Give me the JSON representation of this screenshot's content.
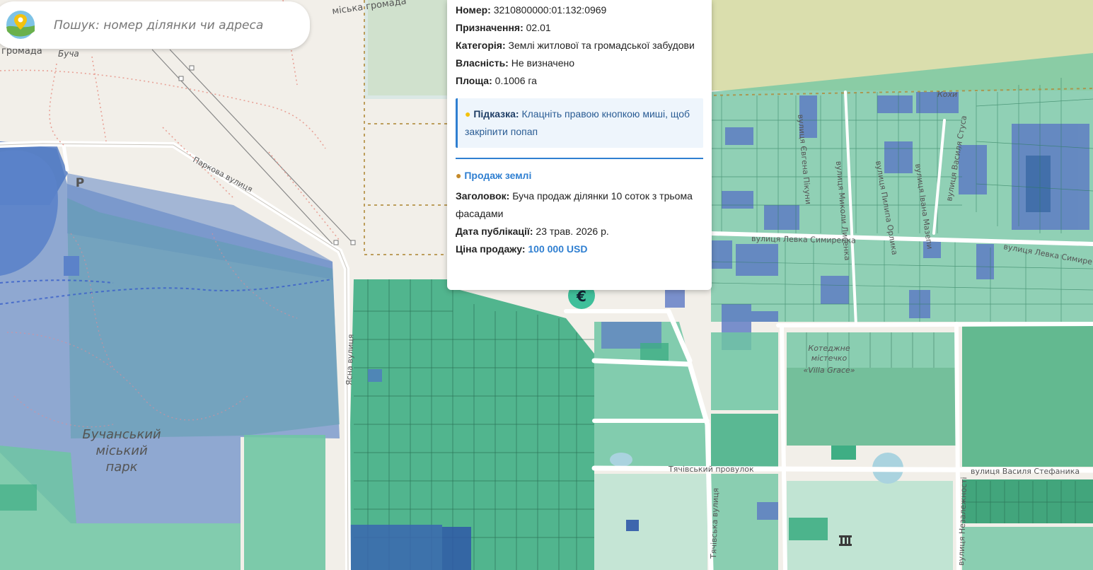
{
  "search": {
    "placeholder": "Пошук: номер ділянки чи адреса"
  },
  "popup": {
    "fields": [
      {
        "label": "Номер:",
        "value": "3210800000:01:132:0969"
      },
      {
        "label": "Призначення:",
        "value": "02.01"
      },
      {
        "label": "Категорія:",
        "value": "Землі житлової та громадської забудови"
      },
      {
        "label": "Власність:",
        "value": "Не визначено"
      },
      {
        "label": "Площа:",
        "value": "0.1006 га"
      }
    ],
    "hint": {
      "icon": "lightbulb-icon",
      "label": "Підказка:",
      "text": "Клацніть правою кнопкою миші, щоб закріпити попап"
    },
    "sale": {
      "icon": "money-bag-icon",
      "title": "Продаж землі",
      "title_label": "Заголовок:",
      "title_value": "Буча продаж ділянки 10 соток з трьома фасадами",
      "date_label": "Дата публікації:",
      "date_value": "23 трав. 2026 р.",
      "price_label": "Ціна продажу:",
      "price_value": "100 000 USD"
    }
  },
  "map_labels": {
    "community_top": "міська громада",
    "community_left": "громада",
    "bucha": "Буча",
    "kokh": "Кохи",
    "park_street": "Паркова вулиця",
    "park_name_1": "Бучанський",
    "park_name_2": "міський",
    "park_name_3": "парк",
    "yasna": "Ясна вулиця",
    "yevhena_pikhunka": "вулиця Євгена Пікуни",
    "mykoly_lysenka_1": "вулиця Миколи Лисенка",
    "pylypa_orlyka": "вулиця Пилипа Орлика",
    "ivana_mazepy": "вулиця Івана Мазепи",
    "vasylia_stusa": "вулиця Василя Стуса",
    "levka_symyrenka_1": "вулиця Левка Симиренка",
    "levka_symyrenka_2": "вулиця Левка Симире",
    "tiachivskyi_lane": "Тячівський провулок",
    "tiachivska": "Тячівська вулиця",
    "vasylia_stefanyka": "вулиця Василя Стефаника",
    "nezalezhnosti": "вулиця Незалежності",
    "cemetery_1": "Котеджне",
    "cemetery_2": "містечко",
    "villa": "«Villa Grace»",
    "parking": "P"
  },
  "colors": {
    "accent": "#2f7fd1",
    "parcel_green": "#3fae84",
    "parcel_teal": "#6fc5a3",
    "parcel_blue": "#5b78c4",
    "park_blue": "#6e90c8"
  }
}
